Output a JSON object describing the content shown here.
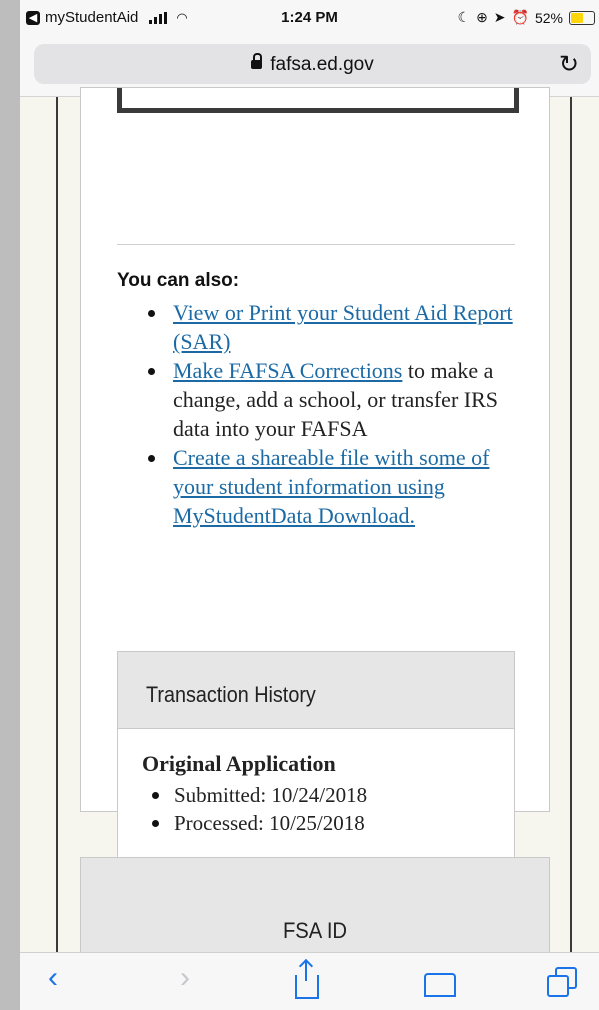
{
  "status_bar": {
    "back_app": "myStudentAid",
    "time": "1:24 PM",
    "battery": "52%",
    "battery_level": 0.52
  },
  "address_bar": {
    "url": "fafsa.ed.gov"
  },
  "content": {
    "also_heading": "You can also:",
    "links": [
      {
        "link": "View or Print your Student Aid Report (SAR)",
        "rest": ""
      },
      {
        "link": "Make FAFSA Corrections",
        "rest": " to make a change, add a school, or transfer IRS data into your FAFSA"
      },
      {
        "link": "Create a shareable file with some of your student information using MyStudentData Download.",
        "rest": ""
      }
    ],
    "transaction_history": {
      "title": "Transaction History",
      "subtitle": "Original Application",
      "items": [
        "Submitted: 10/24/2018",
        "Processed: 10/25/2018"
      ]
    },
    "fsa_id_title": "FSA ID"
  },
  "icons": {
    "reload": "reload-icon",
    "back": "back-chevron-icon",
    "forward": "forward-chevron-icon",
    "share": "share-icon",
    "bookmarks": "book-icon",
    "tabs": "tabs-icon"
  }
}
